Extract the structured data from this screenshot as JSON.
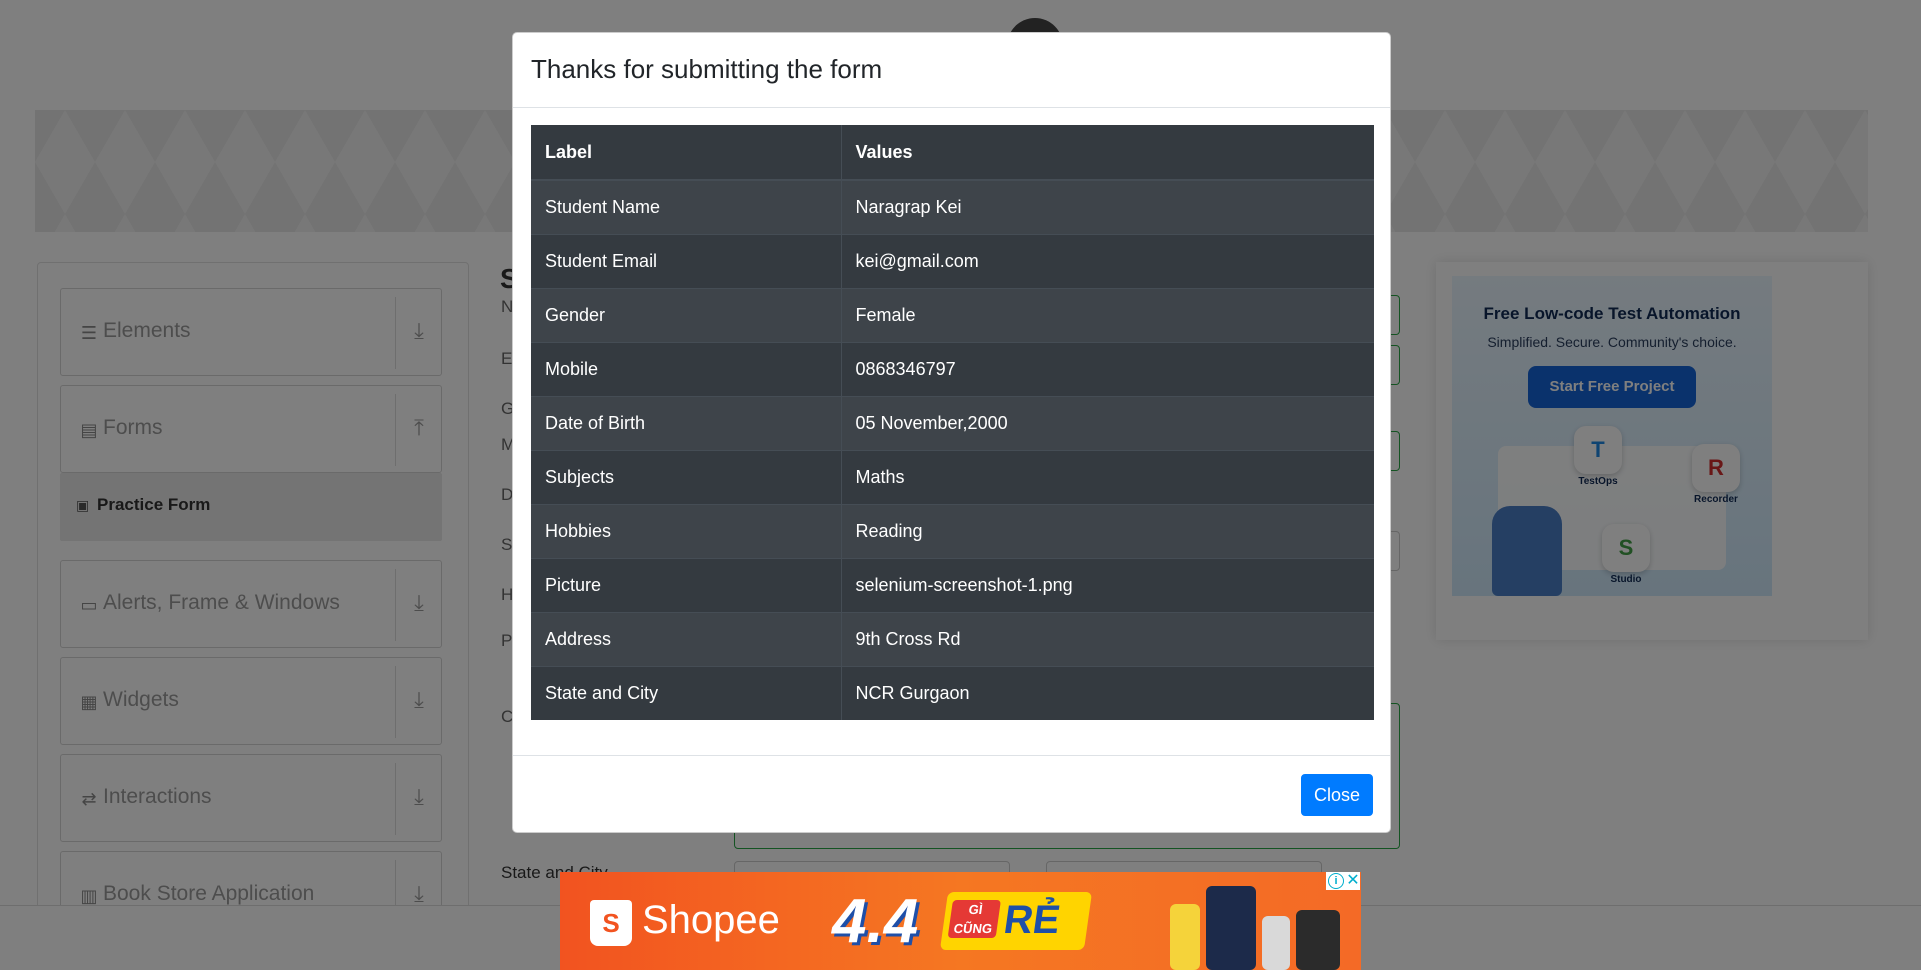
{
  "sidebar": {
    "groups": [
      {
        "label": "Elements",
        "icon": "menu-icon",
        "arrow": "download-icon"
      },
      {
        "label": "Forms",
        "icon": "document-icon",
        "arrow": "upload-icon"
      },
      {
        "label": "Alerts, Frame & Windows",
        "icon": "window-icon",
        "arrow": "download-icon"
      },
      {
        "label": "Widgets",
        "icon": "widgets-icon",
        "arrow": "download-icon"
      },
      {
        "label": "Interactions",
        "icon": "interactions-icon",
        "arrow": "download-icon"
      },
      {
        "label": "Book Store Application",
        "icon": "books-icon",
        "arrow": "download-icon"
      }
    ],
    "active_item": "Practice Form"
  },
  "form": {
    "title_initial": "S",
    "field_initials": [
      "N",
      "E",
      "G",
      "M",
      "D",
      "S",
      "H",
      "P",
      "C"
    ],
    "state_label": "State and City"
  },
  "side_ad": {
    "title": "Free Low-code Test Automation",
    "subtitle": "Simplified. Secure. Community's choice.",
    "button": "Start Free Project",
    "products": [
      "TestOps",
      "Recorder",
      "Studio"
    ]
  },
  "modal": {
    "title": "Thanks for submitting the form",
    "columns": [
      "Label",
      "Values"
    ],
    "rows": [
      {
        "label": "Student Name",
        "value": "Naragrap Kei"
      },
      {
        "label": "Student Email",
        "value": "kei@gmail.com"
      },
      {
        "label": "Gender",
        "value": "Female"
      },
      {
        "label": "Mobile",
        "value": "0868346797"
      },
      {
        "label": "Date of Birth",
        "value": "05 November,2000"
      },
      {
        "label": "Subjects",
        "value": "Maths"
      },
      {
        "label": "Hobbies",
        "value": "Reading"
      },
      {
        "label": "Picture",
        "value": "selenium-screenshot-1.png"
      },
      {
        "label": "Address",
        "value": "9th Cross Rd"
      },
      {
        "label": "State and City",
        "value": "NCR Gurgaon"
      }
    ],
    "close_label": "Close"
  },
  "bottom_ad": {
    "brand": "Shopee",
    "promo_number": "4.4",
    "promo_word": "RẺ",
    "promo_tag": "GÌ CŨNG"
  },
  "colors": {
    "primary": "#007bff",
    "table_dark": "#343a40",
    "success_border": "#28a745",
    "shopee_orange": "#f25320"
  }
}
